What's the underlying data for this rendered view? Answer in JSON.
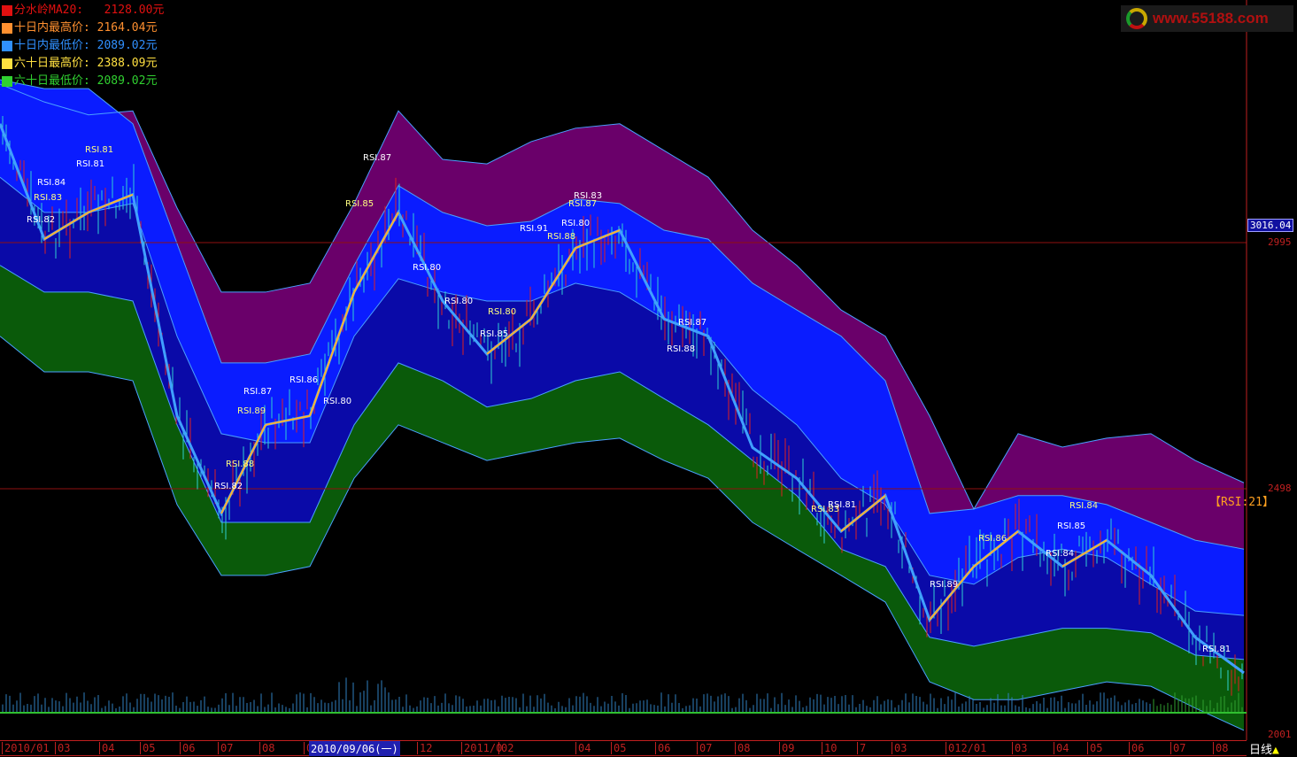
{
  "legend": [
    {
      "label": "分水岭MA20:   2128.00元",
      "color": "#e01010"
    },
    {
      "label": "十日内最高价: 2164.04元",
      "color": "#ff9030"
    },
    {
      "label": "十日内最低价: 2089.02元",
      "color": "#3090ff"
    },
    {
      "label": "六十日最高价: 2388.09元",
      "color": "#ffe040"
    },
    {
      "label": "六十日最低价: 2089.02元",
      "color": "#30d030"
    }
  ],
  "logo": "www.55188.com",
  "current_price": "3016.04",
  "indicator": "【RSI:21】",
  "selected_date": "2010/09/06(一)",
  "period": "日线",
  "period_icon": "triangle-up-icon",
  "chart_data": {
    "type": "area",
    "title": "",
    "y_ticks": [
      "2995",
      "2498",
      "2001"
    ],
    "ylim": [
      2001,
      3485
    ],
    "x_tick_labels": [
      "2010/01",
      "03",
      "04",
      "05",
      "06",
      "07",
      "08",
      "0",
      "12",
      "2011/0",
      "02",
      "04",
      "05",
      "06",
      "07",
      "08",
      "09",
      "10",
      "7",
      "03",
      "012/01",
      "03",
      "04",
      "05",
      "06",
      "07",
      "08"
    ],
    "colors": {
      "purple": "#6a006a",
      "bright_blue": "#0a1cff",
      "dark_blue": "#0a0aa8",
      "green": "#0a5a0a",
      "ma": "#40a0ff",
      "rsi_up": "#ffb030"
    },
    "series": [
      {
        "key": "top",
        "values": [
          3315,
          3279,
          3253,
          3261,
          3065,
          2895,
          2895,
          2913,
          3074,
          3261,
          3163,
          3154,
          3199,
          3226,
          3235,
          3181,
          3127,
          3020,
          2949,
          2859,
          2806,
          2645,
          2457,
          2609,
          2582,
          2600,
          2609,
          2555,
          2510
        ]
      },
      {
        "key": "blue_top",
        "values": [
          3324,
          3306,
          3306,
          3235,
          2993,
          2752,
          2752,
          2770,
          2949,
          3110,
          3056,
          3029,
          3038,
          3083,
          3074,
          3020,
          3002,
          2913,
          2859,
          2806,
          2716,
          2448,
          2457,
          2484,
          2484,
          2466,
          2430,
          2394,
          2376
        ]
      },
      {
        "key": "dark_top",
        "values": [
          3127,
          3056,
          3056,
          3074,
          2806,
          2609,
          2591,
          2591,
          2806,
          2922,
          2895,
          2877,
          2877,
          2913,
          2895,
          2841,
          2806,
          2698,
          2627,
          2519,
          2466,
          2323,
          2305,
          2359,
          2376,
          2359,
          2305,
          2251,
          2242
        ]
      },
      {
        "key": "green_top",
        "values": [
          2949,
          2895,
          2895,
          2877,
          2627,
          2430,
          2430,
          2430,
          2627,
          2752,
          2716,
          2663,
          2680,
          2716,
          2734,
          2680,
          2627,
          2555,
          2484,
          2376,
          2341,
          2198,
          2180,
          2198,
          2216,
          2216,
          2207,
          2162,
          2153
        ]
      },
      {
        "key": "green_bottom",
        "values": [
          2806,
          2734,
          2734,
          2716,
          2466,
          2323,
          2323,
          2341,
          2519,
          2627,
          2591,
          2555,
          2573,
          2591,
          2600,
          2555,
          2519,
          2430,
          2376,
          2323,
          2269,
          2108,
          2072,
          2072,
          2090,
          2108,
          2099,
          2055,
          2010
        ]
      },
      {
        "key": "ma",
        "values": [
          3235,
          3002,
          3056,
          3092,
          2645,
          2448,
          2627,
          2645,
          2895,
          3056,
          2877,
          2770,
          2841,
          2984,
          3020,
          2841,
          2806,
          2581,
          2519,
          2412,
          2484,
          2233,
          2341,
          2412,
          2341,
          2394,
          2323,
          2198,
          2126
        ]
      }
    ],
    "rsi_labels": [
      "RSI.81",
      "RSI.81",
      "RSI.84",
      "RSI.83",
      "RSI.82",
      "RSI.87",
      "RSI.89",
      "RSI.86",
      "RSI.80",
      "RSI.88",
      "RSI.82",
      "RSI.87",
      "RSI.85",
      "RSI.80",
      "RSI.80",
      "RSI.80",
      "RSI.85",
      "RSI.91",
      "RSI.88",
      "RSI.80",
      "RSI.83",
      "RSI.87",
      "RSI.87",
      "RSI.88",
      "RSI.83",
      "RSI.81",
      "RSI.89",
      "RSI.86",
      "RSI.85",
      "RSI.84",
      "RSI.84",
      "RSI.81"
    ]
  }
}
